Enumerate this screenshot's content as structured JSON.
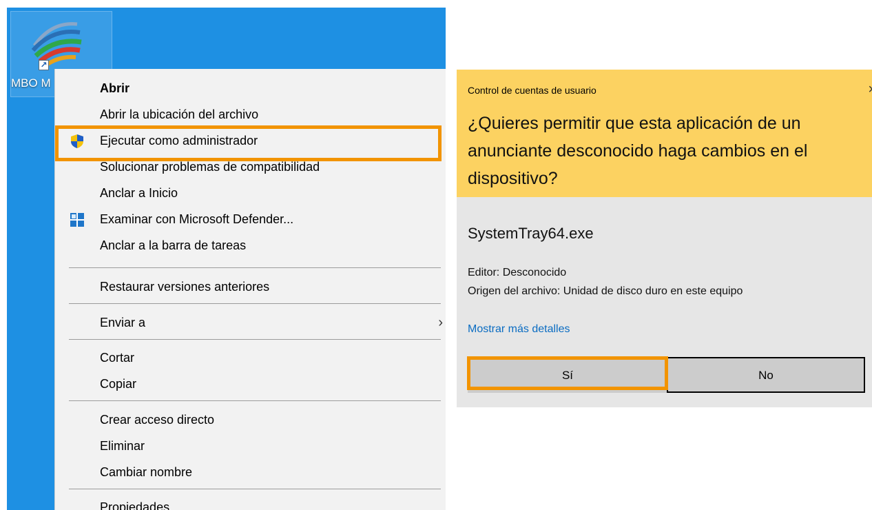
{
  "desktop": {
    "icon_label": "MBO M",
    "icon_name": "mbo-app-logo"
  },
  "context_menu": {
    "items": [
      {
        "label": "Abrir",
        "bold": true
      },
      {
        "label": "Abrir la ubicación del archivo"
      },
      {
        "label": "Ejecutar como administrador",
        "icon": "uac-shield-icon",
        "highlighted": true
      },
      {
        "label": "Solucionar problemas de compatibilidad"
      },
      {
        "label": "Anclar a Inicio"
      },
      {
        "label": "Examinar con Microsoft Defender...",
        "icon": "defender-icon"
      },
      {
        "label": "Anclar a la barra de tareas"
      },
      {
        "label": "Restaurar versiones anteriores"
      },
      {
        "label": "Enviar a",
        "submenu": true
      },
      {
        "label": "Cortar"
      },
      {
        "label": "Copiar"
      },
      {
        "label": "Crear acceso directo"
      },
      {
        "label": "Eliminar"
      },
      {
        "label": "Cambiar nombre"
      },
      {
        "label": "Propiedades"
      }
    ],
    "submenu_glyph": "›"
  },
  "uac": {
    "title": "Control de cuentas de usuario",
    "close_glyph": "×",
    "question": "¿Quieres permitir que esta aplicación de un anunciante desconocido haga cambios en el dispositivo?",
    "filename": "SystemTray64.exe",
    "editor": "Editor: Desconocido",
    "origin": "Origen del archivo: Unidad de disco duro en este equipo",
    "details_link": "Mostrar más detalles",
    "yes_label": "Sí",
    "no_label": "No"
  },
  "colors": {
    "desktop_bg": "#1e90e3",
    "menu_bg": "#f2f2f2",
    "uac_header": "#fcd261",
    "uac_body": "#e6e6e6",
    "highlight": "#f29400",
    "link": "#0a6cc2"
  }
}
